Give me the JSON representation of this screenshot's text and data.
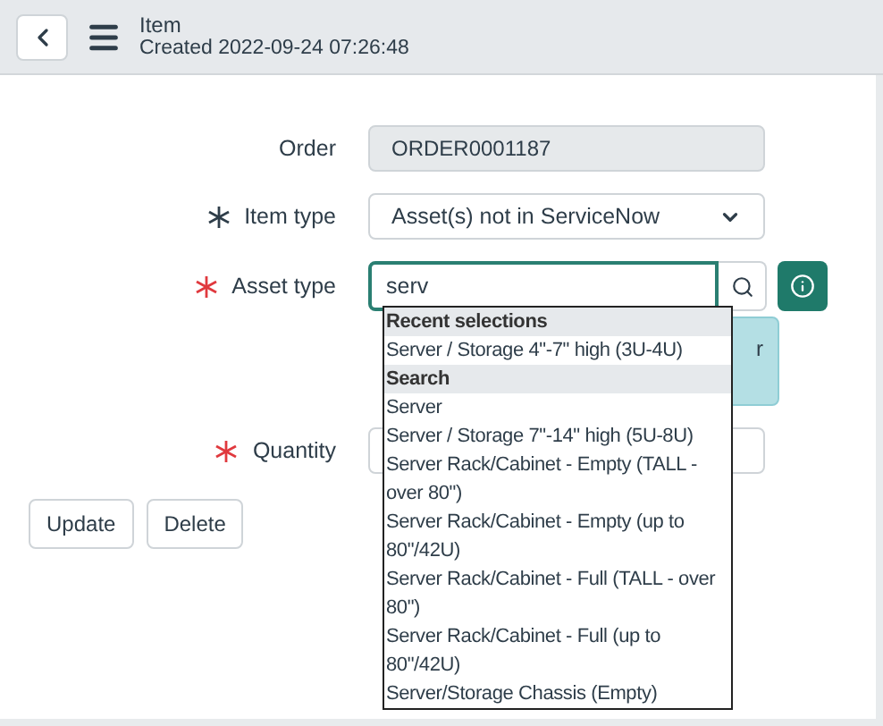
{
  "header": {
    "title": "Item",
    "subtitle": "Created 2022-09-24 07:26:48"
  },
  "fields": [
    {
      "kind": "readonly",
      "label": "Order",
      "value": "ORDER0001187",
      "required": false
    },
    {
      "kind": "select",
      "label": "Item type",
      "value": "Asset(s) not in ServiceNow",
      "required": true,
      "color": "#2e3d49"
    },
    {
      "kind": "lookup",
      "label": "Asset type",
      "value": "serv",
      "required": true,
      "color": "#e0393e"
    },
    {
      "kind": "text",
      "label": "Quantity",
      "required": true,
      "color": "#e0393e"
    }
  ],
  "info_box": {
    "text": "r"
  },
  "dropdown": {
    "groups": [
      {
        "heading": "Recent selections",
        "items": [
          "Server / Storage 4\"-7\" high (3U-4U)"
        ]
      },
      {
        "heading": "Search",
        "items": [
          "Server",
          "Server / Storage 7\"-14\" high (5U-8U)",
          "Server Rack/Cabinet - Empty (TALL - over 80\")",
          "Server Rack/Cabinet - Empty (up to 80\"/42U)",
          "Server Rack/Cabinet - Full (TALL - over 80\")",
          "Server Rack/Cabinet - Full (up to 80\"/42U)",
          "Server/Storage Chassis (Empty)"
        ]
      }
    ]
  },
  "buttons": [
    "Update",
    "Delete"
  ]
}
